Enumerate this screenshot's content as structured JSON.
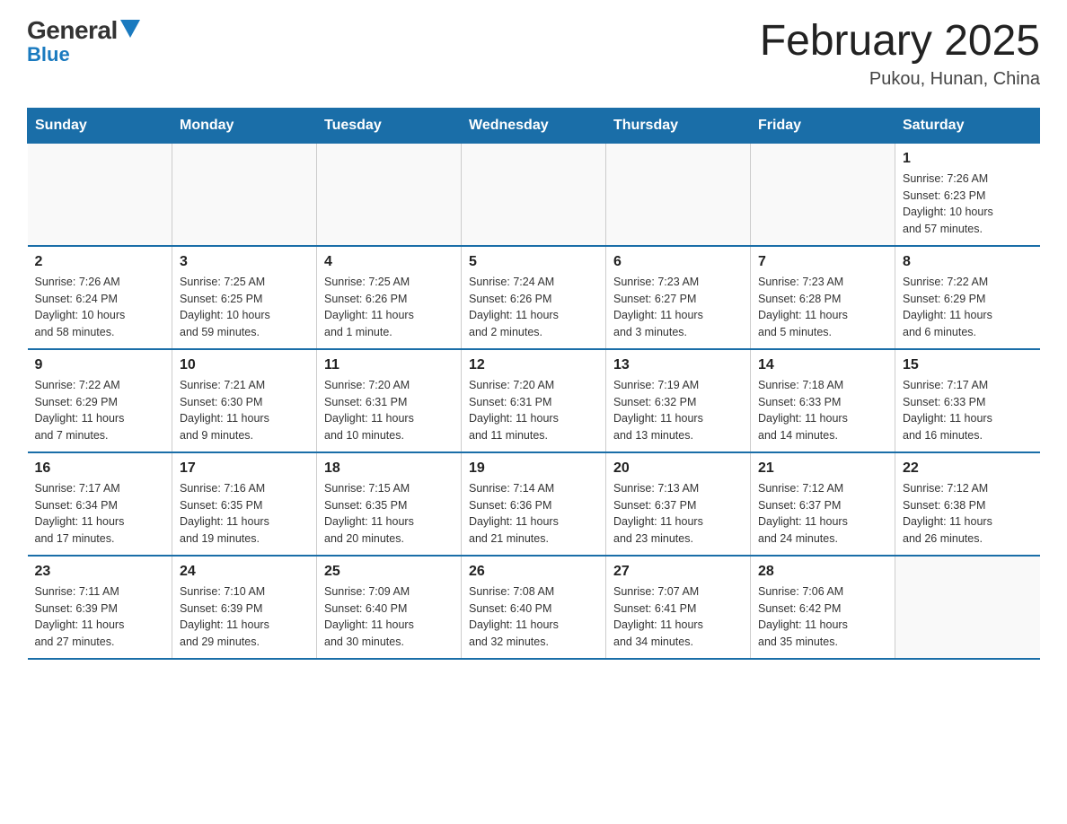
{
  "header": {
    "logo_general": "General",
    "logo_blue": "Blue",
    "title": "February 2025",
    "subtitle": "Pukou, Hunan, China"
  },
  "days_of_week": [
    "Sunday",
    "Monday",
    "Tuesday",
    "Wednesday",
    "Thursday",
    "Friday",
    "Saturday"
  ],
  "weeks": [
    {
      "days": [
        {
          "num": "",
          "info": ""
        },
        {
          "num": "",
          "info": ""
        },
        {
          "num": "",
          "info": ""
        },
        {
          "num": "",
          "info": ""
        },
        {
          "num": "",
          "info": ""
        },
        {
          "num": "",
          "info": ""
        },
        {
          "num": "1",
          "info": "Sunrise: 7:26 AM\nSunset: 6:23 PM\nDaylight: 10 hours\nand 57 minutes."
        }
      ]
    },
    {
      "days": [
        {
          "num": "2",
          "info": "Sunrise: 7:26 AM\nSunset: 6:24 PM\nDaylight: 10 hours\nand 58 minutes."
        },
        {
          "num": "3",
          "info": "Sunrise: 7:25 AM\nSunset: 6:25 PM\nDaylight: 10 hours\nand 59 minutes."
        },
        {
          "num": "4",
          "info": "Sunrise: 7:25 AM\nSunset: 6:26 PM\nDaylight: 11 hours\nand 1 minute."
        },
        {
          "num": "5",
          "info": "Sunrise: 7:24 AM\nSunset: 6:26 PM\nDaylight: 11 hours\nand 2 minutes."
        },
        {
          "num": "6",
          "info": "Sunrise: 7:23 AM\nSunset: 6:27 PM\nDaylight: 11 hours\nand 3 minutes."
        },
        {
          "num": "7",
          "info": "Sunrise: 7:23 AM\nSunset: 6:28 PM\nDaylight: 11 hours\nand 5 minutes."
        },
        {
          "num": "8",
          "info": "Sunrise: 7:22 AM\nSunset: 6:29 PM\nDaylight: 11 hours\nand 6 minutes."
        }
      ]
    },
    {
      "days": [
        {
          "num": "9",
          "info": "Sunrise: 7:22 AM\nSunset: 6:29 PM\nDaylight: 11 hours\nand 7 minutes."
        },
        {
          "num": "10",
          "info": "Sunrise: 7:21 AM\nSunset: 6:30 PM\nDaylight: 11 hours\nand 9 minutes."
        },
        {
          "num": "11",
          "info": "Sunrise: 7:20 AM\nSunset: 6:31 PM\nDaylight: 11 hours\nand 10 minutes."
        },
        {
          "num": "12",
          "info": "Sunrise: 7:20 AM\nSunset: 6:31 PM\nDaylight: 11 hours\nand 11 minutes."
        },
        {
          "num": "13",
          "info": "Sunrise: 7:19 AM\nSunset: 6:32 PM\nDaylight: 11 hours\nand 13 minutes."
        },
        {
          "num": "14",
          "info": "Sunrise: 7:18 AM\nSunset: 6:33 PM\nDaylight: 11 hours\nand 14 minutes."
        },
        {
          "num": "15",
          "info": "Sunrise: 7:17 AM\nSunset: 6:33 PM\nDaylight: 11 hours\nand 16 minutes."
        }
      ]
    },
    {
      "days": [
        {
          "num": "16",
          "info": "Sunrise: 7:17 AM\nSunset: 6:34 PM\nDaylight: 11 hours\nand 17 minutes."
        },
        {
          "num": "17",
          "info": "Sunrise: 7:16 AM\nSunset: 6:35 PM\nDaylight: 11 hours\nand 19 minutes."
        },
        {
          "num": "18",
          "info": "Sunrise: 7:15 AM\nSunset: 6:35 PM\nDaylight: 11 hours\nand 20 minutes."
        },
        {
          "num": "19",
          "info": "Sunrise: 7:14 AM\nSunset: 6:36 PM\nDaylight: 11 hours\nand 21 minutes."
        },
        {
          "num": "20",
          "info": "Sunrise: 7:13 AM\nSunset: 6:37 PM\nDaylight: 11 hours\nand 23 minutes."
        },
        {
          "num": "21",
          "info": "Sunrise: 7:12 AM\nSunset: 6:37 PM\nDaylight: 11 hours\nand 24 minutes."
        },
        {
          "num": "22",
          "info": "Sunrise: 7:12 AM\nSunset: 6:38 PM\nDaylight: 11 hours\nand 26 minutes."
        }
      ]
    },
    {
      "days": [
        {
          "num": "23",
          "info": "Sunrise: 7:11 AM\nSunset: 6:39 PM\nDaylight: 11 hours\nand 27 minutes."
        },
        {
          "num": "24",
          "info": "Sunrise: 7:10 AM\nSunset: 6:39 PM\nDaylight: 11 hours\nand 29 minutes."
        },
        {
          "num": "25",
          "info": "Sunrise: 7:09 AM\nSunset: 6:40 PM\nDaylight: 11 hours\nand 30 minutes."
        },
        {
          "num": "26",
          "info": "Sunrise: 7:08 AM\nSunset: 6:40 PM\nDaylight: 11 hours\nand 32 minutes."
        },
        {
          "num": "27",
          "info": "Sunrise: 7:07 AM\nSunset: 6:41 PM\nDaylight: 11 hours\nand 34 minutes."
        },
        {
          "num": "28",
          "info": "Sunrise: 7:06 AM\nSunset: 6:42 PM\nDaylight: 11 hours\nand 35 minutes."
        },
        {
          "num": "",
          "info": ""
        }
      ]
    }
  ]
}
